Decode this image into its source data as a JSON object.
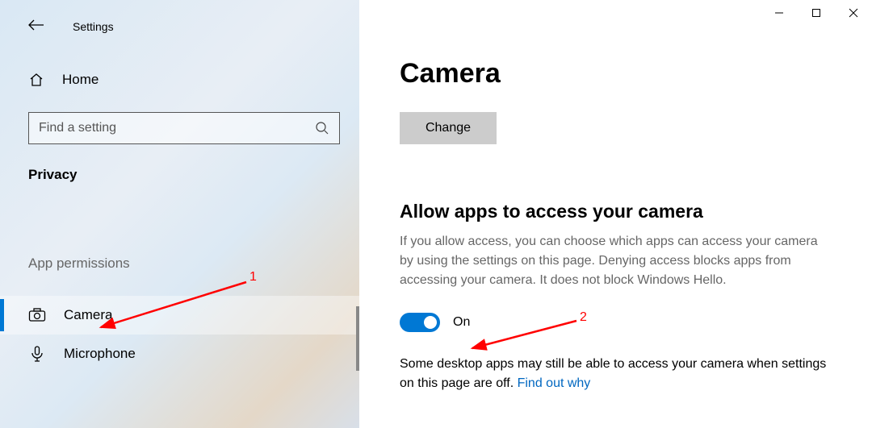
{
  "window": {
    "title": "Settings"
  },
  "sidebar": {
    "home_label": "Home",
    "search_placeholder": "Find a setting",
    "category": "Privacy",
    "section": "App permissions",
    "items": [
      {
        "label": "Camera",
        "selected": true
      },
      {
        "label": "Microphone",
        "selected": false
      }
    ]
  },
  "main": {
    "title": "Camera",
    "change_button": "Change",
    "allow_heading": "Allow apps to access your camera",
    "allow_desc": "If you allow access, you can choose which apps can access your camera by using the settings on this page. Denying access blocks apps from accessing your camera. It does not block Windows Hello.",
    "toggle_state": "On",
    "footnote_text": "Some desktop apps may still be able to access your camera when settings on this page are off. ",
    "footnote_link": "Find out why"
  },
  "annotations": {
    "label1": "1",
    "label2": "2"
  }
}
